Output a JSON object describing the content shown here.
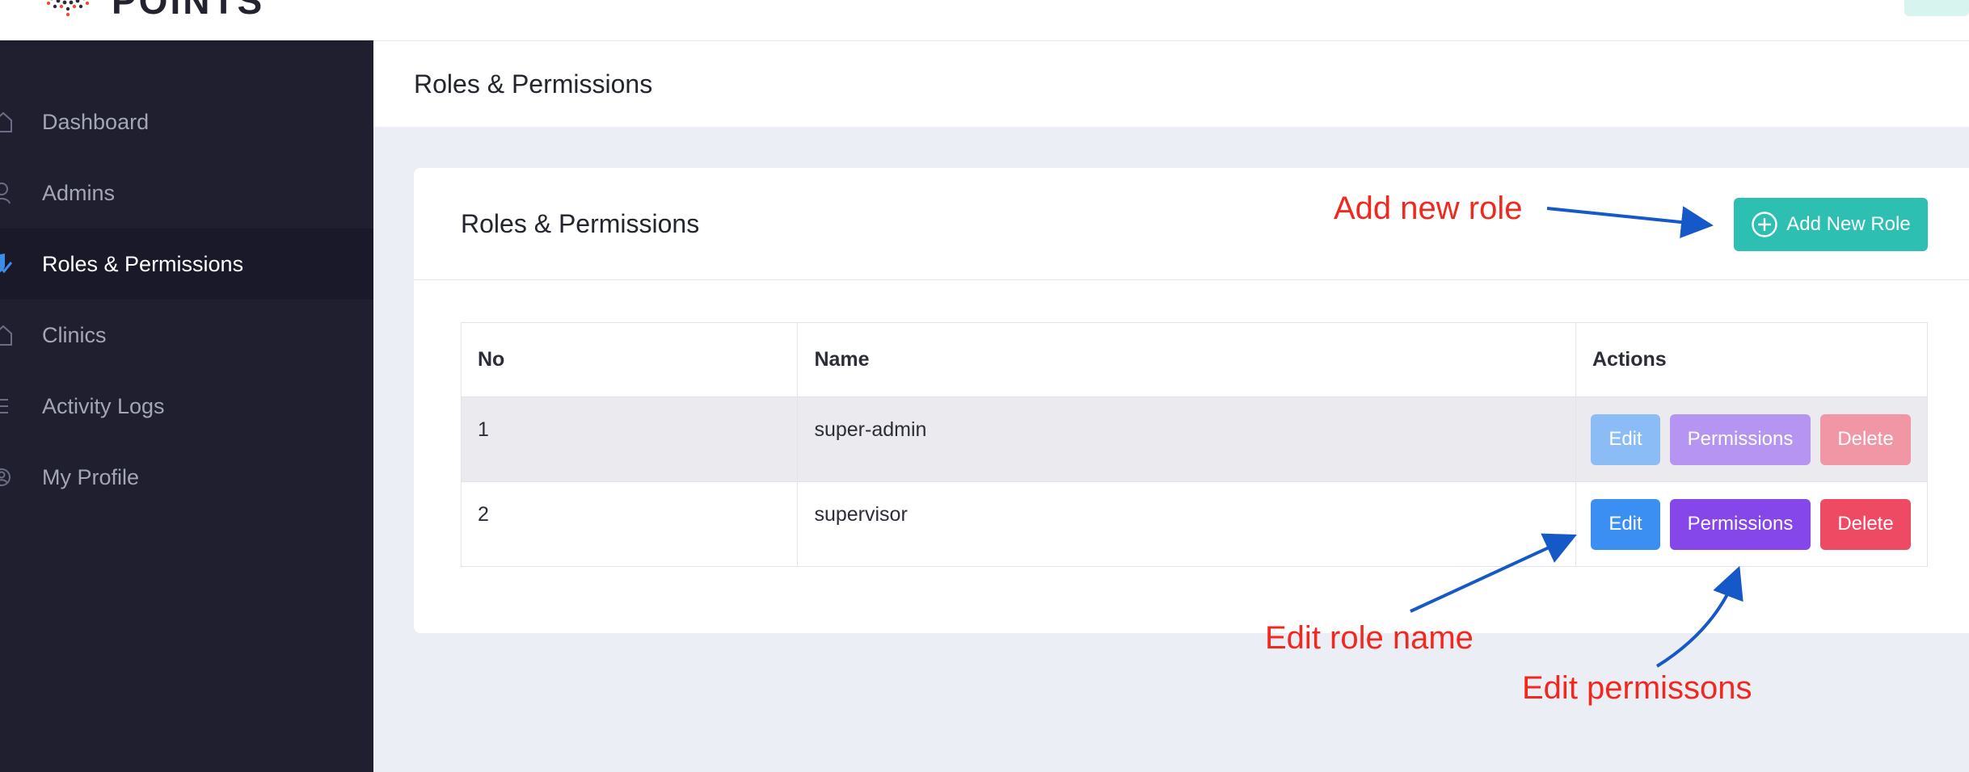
{
  "brand": {
    "name": "POINTS",
    "logo_icon": "dotted-logo-icon",
    "toggle_icon": "menu-toggle-icon"
  },
  "sidebar": {
    "items": [
      {
        "label": "Dashboard",
        "icon": "home-icon",
        "active": false
      },
      {
        "label": "Admins",
        "icon": "user-icon",
        "active": false
      },
      {
        "label": "Roles & Permissions",
        "icon": "shield-check-icon",
        "active": true
      },
      {
        "label": "Clinics",
        "icon": "clinic-icon",
        "active": false
      },
      {
        "label": "Activity Logs",
        "icon": "list-icon",
        "active": false
      },
      {
        "label": "My Profile",
        "icon": "profile-icon",
        "active": false
      }
    ]
  },
  "page": {
    "title": "Roles & Permissions"
  },
  "card": {
    "title": "Roles & Permissions",
    "add_button": {
      "label": "Add New Role",
      "icon": "plus-circle-icon"
    }
  },
  "table": {
    "headers": {
      "no": "No",
      "name": "Name",
      "actions": "Actions"
    },
    "rows": [
      {
        "no": "1",
        "name": "super-admin",
        "disabled": true,
        "edit": "Edit",
        "permissions": "Permissions",
        "delete": "Delete"
      },
      {
        "no": "2",
        "name": "supervisor",
        "disabled": false,
        "edit": "Edit",
        "permissions": "Permissions",
        "delete": "Delete"
      }
    ]
  },
  "annotations": {
    "add_new_role": "Add new role",
    "edit_role_name": "Edit role name",
    "edit_permissions": "Edit permissons"
  },
  "colors": {
    "sidebar_bg": "#1f1f2f",
    "accent_teal": "#2cbfb2",
    "edit_blue": "#3c8ff2",
    "permissions_purple": "#8546ea",
    "delete_red": "#ee4a64",
    "annotation_red": "#f0281e",
    "arrow_blue": "#1558c8"
  }
}
